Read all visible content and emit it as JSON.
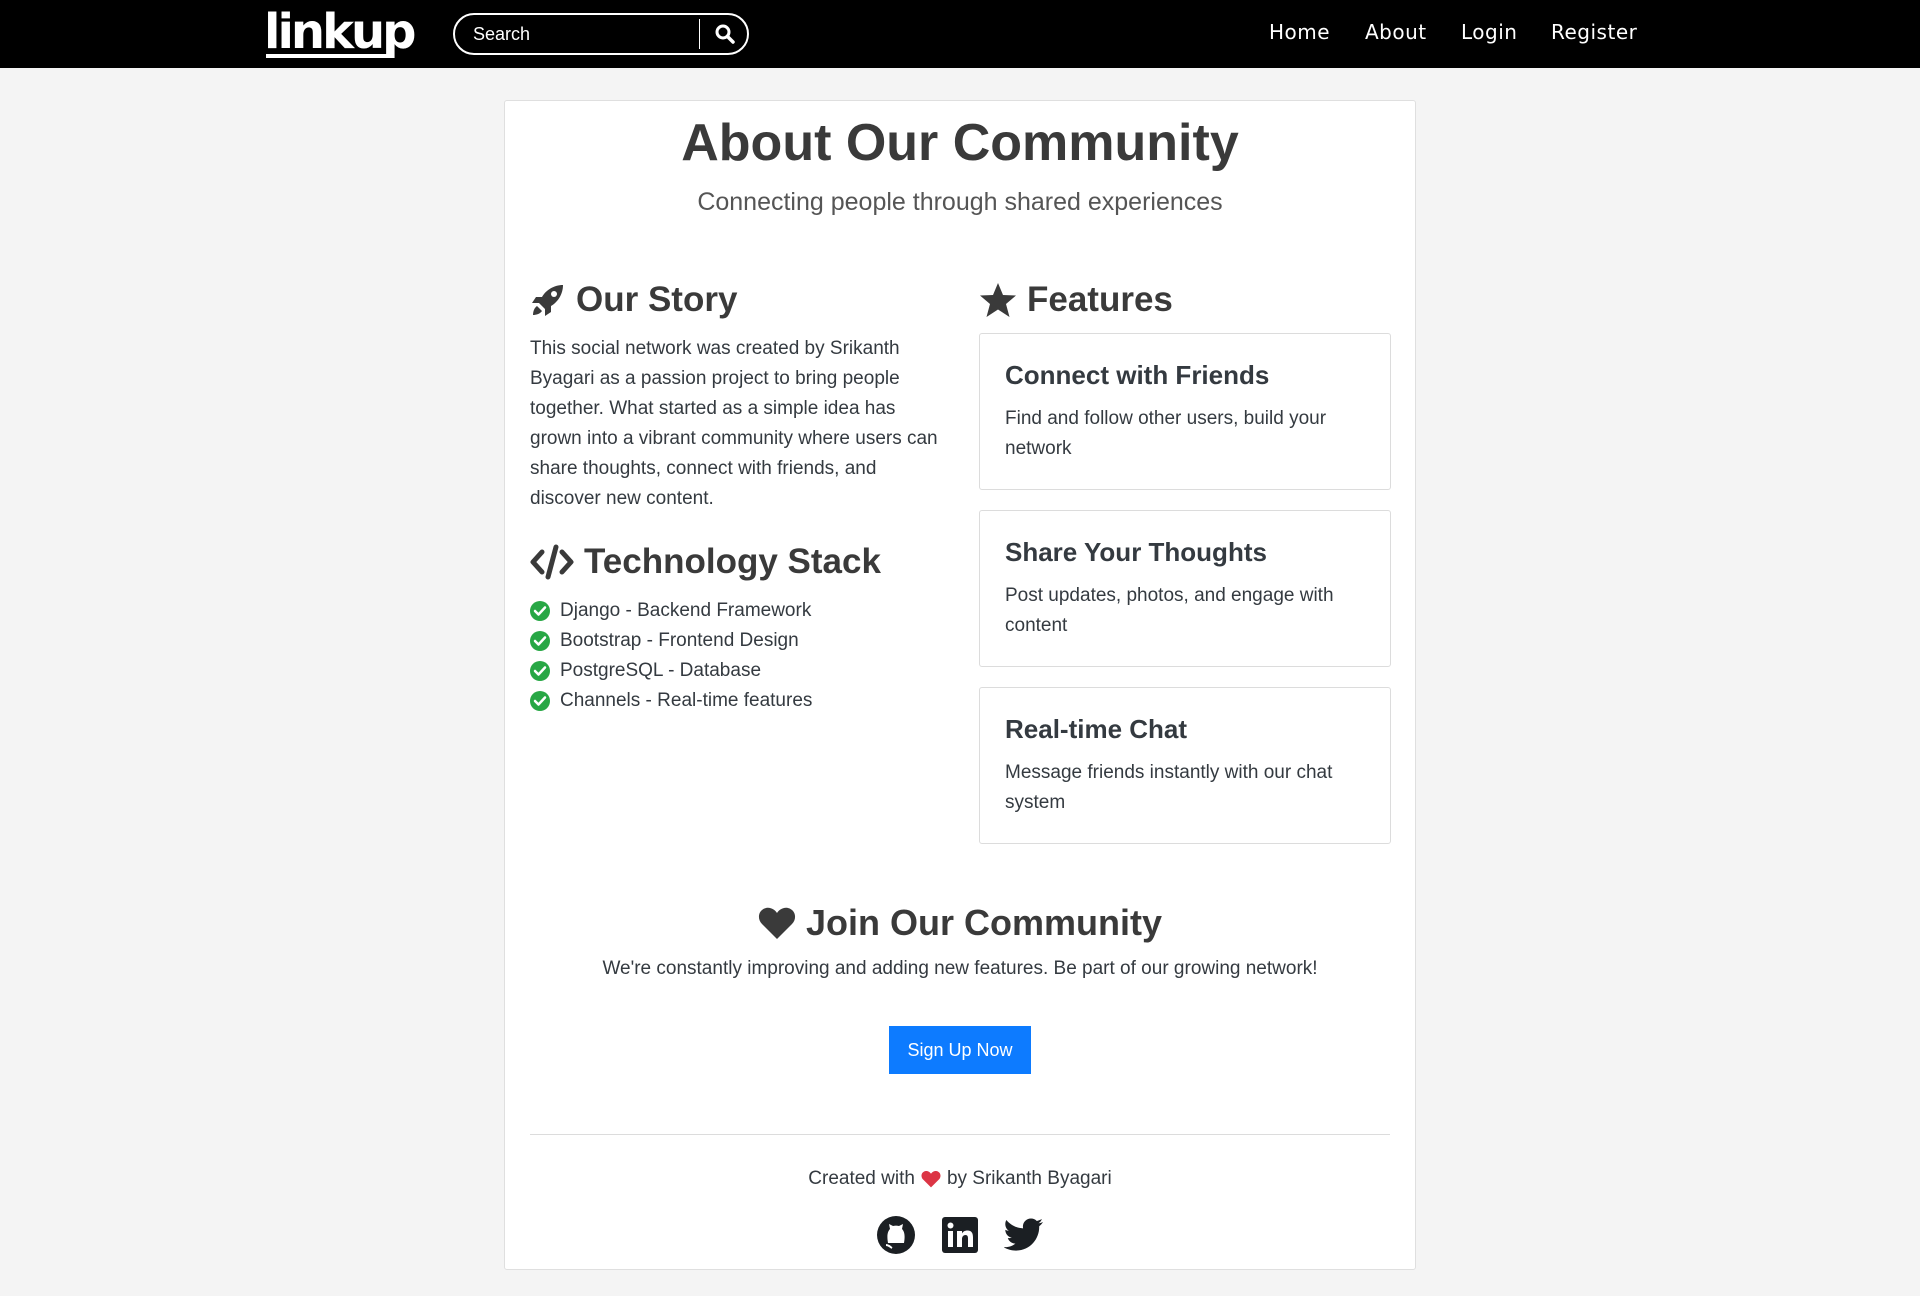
{
  "navbar": {
    "logo": "linkup",
    "search_placeholder": "Search",
    "links": [
      "Home",
      "About",
      "Login",
      "Register"
    ]
  },
  "header": {
    "title": "About Our Community",
    "subtitle": "Connecting people through shared experiences"
  },
  "story": {
    "heading": "Our Story",
    "icon": "rocket-icon",
    "text": "This social network was created by Srikanth Byagari as a passion project to bring people together. What started as a simple idea has grown into a vibrant community where users can share thoughts, connect with friends, and discover new content."
  },
  "tech": {
    "heading": "Technology Stack",
    "icon": "code-icon",
    "items": [
      "Django - Backend Framework",
      "Bootstrap - Frontend Design",
      "PostgreSQL - Database",
      "Channels - Real-time features"
    ]
  },
  "features": {
    "heading": "Features",
    "icon": "star-icon",
    "items": [
      {
        "title": "Connect with Friends",
        "desc": "Find and follow other users, build your network"
      },
      {
        "title": "Share Your Thoughts",
        "desc": "Post updates, photos, and engage with content"
      },
      {
        "title": "Real-time Chat",
        "desc": "Message friends instantly with our chat system"
      }
    ]
  },
  "join": {
    "heading": "Join Our Community",
    "icon": "heart-icon",
    "text": "We're constantly improving and adding new features. Be part of our growing network!",
    "button": "Sign Up Now"
  },
  "footer": {
    "prefix": "Created with",
    "suffix": "by Srikanth Byagari",
    "social": [
      "github-icon",
      "linkedin-icon",
      "twitter-icon"
    ]
  },
  "colors": {
    "navbar_bg": "#000000",
    "primary": "#0d7bff",
    "success": "#28a745",
    "heart": "#dc3545",
    "text": "#343a40"
  }
}
